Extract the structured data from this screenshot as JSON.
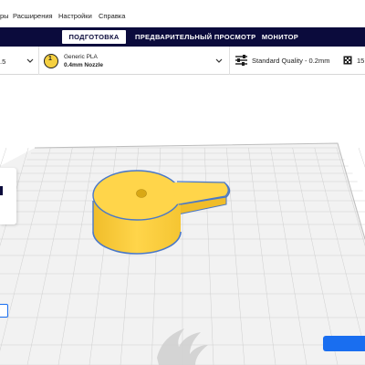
{
  "menu": {
    "items": [
      "ры",
      "Расширения",
      "Настройки",
      "Справка"
    ]
  },
  "stages": {
    "tabs": [
      {
        "label": "ПОДГОТОВКА",
        "active": true
      },
      {
        "label": "ПРЕДВАРИТЕЛЬНЫЙ ПРОСМОТР",
        "active": false
      },
      {
        "label": "МОНИТОР",
        "active": false
      }
    ]
  },
  "settings": {
    "printer_fragment": ".5",
    "material": {
      "slot": "1",
      "name": "Generic PLA",
      "nozzle": "0.4mm Nozzle"
    },
    "profile": "Standard Quality - 0.2mm",
    "infill_fragment": "15"
  },
  "colors": {
    "header_bg": "#0b0b3c",
    "accent": "#196ef0",
    "model_fill": "#ffd54a",
    "material_badge": "#f5d041",
    "build_plate": "#f2f2f2",
    "grid_line": "#c9c9c9"
  },
  "icons": [
    "chevron-down-icon",
    "material-slot-icon",
    "settings-sliders-icon",
    "infill-icon",
    "ultimaker-logo-icon"
  ]
}
